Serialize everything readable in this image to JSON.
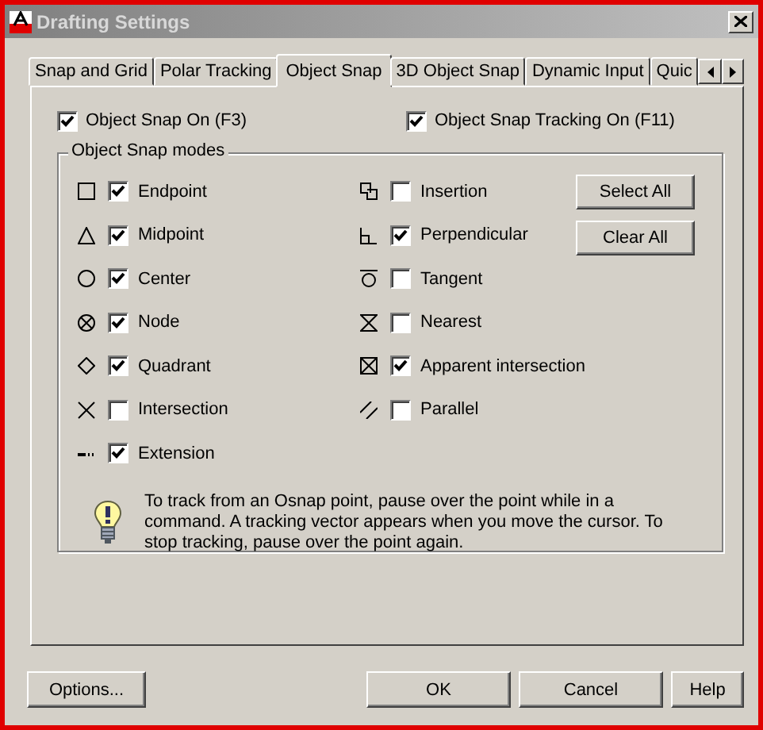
{
  "window": {
    "title": "Drafting Settings"
  },
  "tabs": [
    {
      "label": "Snap and Grid",
      "selected": false
    },
    {
      "label": "Polar Tracking",
      "selected": false
    },
    {
      "label": "Object Snap",
      "selected": true
    },
    {
      "label": "3D Object Snap",
      "selected": false
    },
    {
      "label": "Dynamic Input",
      "selected": false
    },
    {
      "label": "Quic",
      "selected": false
    }
  ],
  "toggles": [
    {
      "label": "Object Snap On (F3)",
      "checked": true
    },
    {
      "label": "Object Snap Tracking On (F11)",
      "checked": true
    }
  ],
  "modes_group": {
    "title": "Object Snap modes",
    "columns": [
      {
        "modes": [
          {
            "kind": "endpoint",
            "label": "Endpoint",
            "checked": true
          },
          {
            "kind": "midpoint",
            "label": "Midpoint",
            "checked": true
          },
          {
            "kind": "center",
            "label": "Center",
            "checked": true
          },
          {
            "kind": "node",
            "label": "Node",
            "checked": true
          },
          {
            "kind": "quadrant",
            "label": "Quadrant",
            "checked": true
          },
          {
            "kind": "intersection",
            "label": "Intersection",
            "checked": false
          },
          {
            "kind": "extension",
            "label": "Extension",
            "checked": true
          }
        ]
      },
      {
        "modes": [
          {
            "kind": "insertion",
            "label": "Insertion",
            "checked": false
          },
          {
            "kind": "perpendicular",
            "label": "Perpendicular",
            "checked": true
          },
          {
            "kind": "tangent",
            "label": "Tangent",
            "checked": false
          },
          {
            "kind": "nearest",
            "label": "Nearest",
            "checked": false
          },
          {
            "kind": "apparent",
            "label": "Apparent intersection",
            "checked": true
          },
          {
            "kind": "parallel",
            "label": "Parallel",
            "checked": false
          }
        ]
      }
    ],
    "buttons": [
      "Select All",
      "Clear All"
    ],
    "hint": "To track from an Osnap point, pause over the point while in a command.  A tracking vector appears when you move the cursor. To stop tracking, pause over the point again."
  },
  "footer": {
    "left_button": "Options...",
    "buttons": [
      "OK",
      "Cancel",
      "Help"
    ]
  }
}
